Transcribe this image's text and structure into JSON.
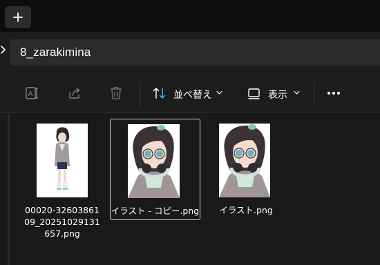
{
  "tab_strip": {
    "new_tab_icon": "plus-icon"
  },
  "address_bar": {
    "chevron_icon": "chevron-right-icon",
    "folder_name": "8_zarakimina"
  },
  "command_bar": {
    "rename_icon": "rename-icon",
    "share_icon": "share-icon",
    "delete_icon": "trash-icon",
    "sort": {
      "icon": "sort-icon",
      "label": "並べ替え"
    },
    "view": {
      "icon": "view-icon",
      "label": "表示"
    },
    "more_icon": "ellipsis-icon"
  },
  "files": [
    {
      "name": "00020-32603861\n09_20251029131\n657.png",
      "selected": false,
      "thumbnail": "full-body anime girl illustration"
    },
    {
      "name": "イラスト - コピー.png",
      "selected": true,
      "thumbnail": "anime girl with headphones"
    },
    {
      "name": "イラスト.png",
      "selected": false,
      "thumbnail": "anime girl with headphones"
    }
  ],
  "colors": {
    "background": "#191919",
    "tabstrip": "#0c0c0c",
    "field": "#2b2b2b",
    "sort_icon_accent": "#4fb3f0",
    "selection_border": "#d7d7d7"
  }
}
